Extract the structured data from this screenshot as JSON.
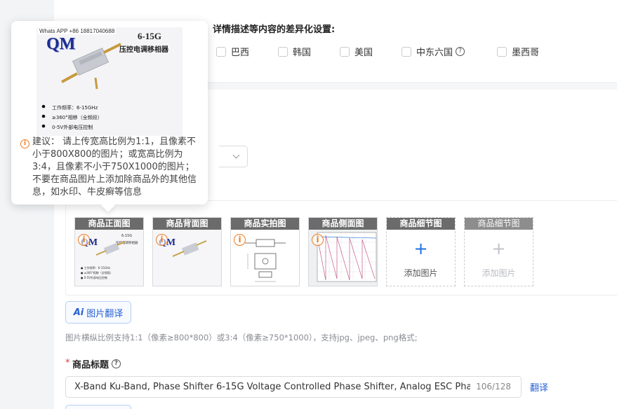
{
  "diff_section": {
    "title": "详情描述等内容的差异化设置:",
    "countries": [
      {
        "label": "巴西"
      },
      {
        "label": "韩国"
      },
      {
        "label": "美国"
      },
      {
        "label": "中东六国",
        "has_help": true
      },
      {
        "label": "墨西哥"
      }
    ],
    "help_icon": "?"
  },
  "image_slots": [
    {
      "label": "商品正面图",
      "state": "filled",
      "warning": "i"
    },
    {
      "label": "商品背面图",
      "state": "filled",
      "warning": "i"
    },
    {
      "label": "商品实拍图",
      "state": "filled",
      "warning": "i"
    },
    {
      "label": "商品侧面图",
      "state": "filled",
      "warning": "i"
    },
    {
      "label": "商品细节图",
      "state": "empty",
      "plus": "+",
      "add_text": "添加图片"
    },
    {
      "label": "商品细节图",
      "state": "disabled",
      "plus": "+",
      "add_text": "添加图片"
    }
  ],
  "translate_button": {
    "ai": "Ai",
    "label": "图片翻译"
  },
  "hint": "图片横纵比例支持1:1（像素≥800*800）或3:4（像素≥750*1000），支持jpg、jpeg、png格式;",
  "product_title": {
    "required_mark": "*",
    "label": "商品标题",
    "value": "X-Band Ku-Band, Phase Shifter 6-15G Voltage Controlled Phase Shifter, Analog ESC Phase S",
    "count": "106/128",
    "translate_link": "翻译"
  },
  "tooltip": {
    "image_text": {
      "whatsapp": "Whats APP +86 18817040688",
      "logo": "QM",
      "freq": "6-15G",
      "name": "压控电调移相器",
      "bullets": [
        "工作频率：6-15GHz",
        "≥360°相移（全频段）",
        "0-5V外部电压控制"
      ]
    },
    "text": "建议：  请上传宽高比例为1:1，且像素不小于800X800的图片；或宽高比例为3:4，且像素不小于750X1000的图片；不要在商品图片上添加除商品外的其他信息，如水印、牛皮癣等信息"
  },
  "colors": {
    "accent": "#2761d6",
    "warning": "#ef7b1e",
    "slot_label": "#6b6b6b"
  }
}
